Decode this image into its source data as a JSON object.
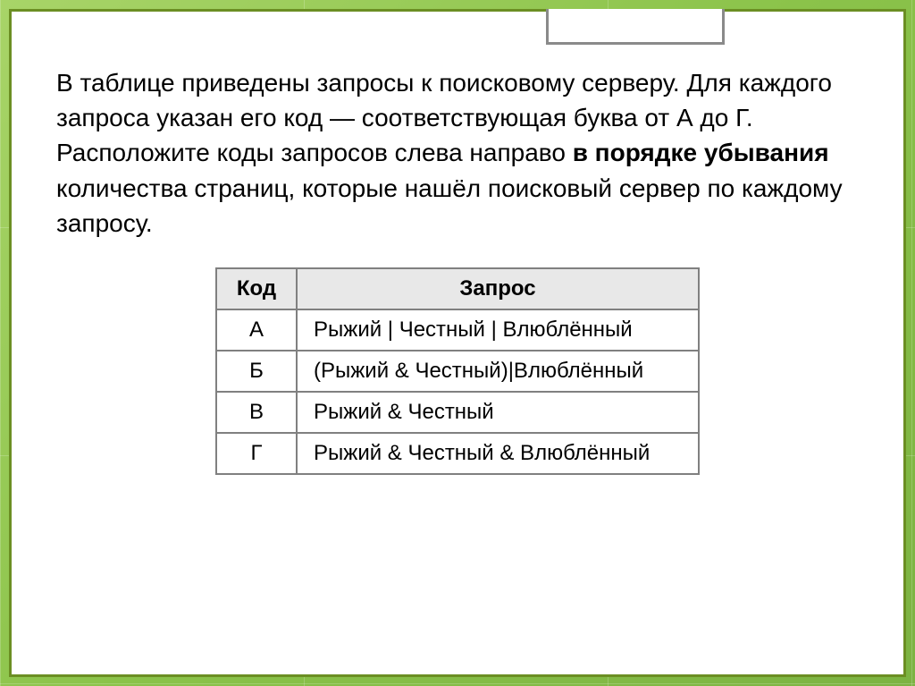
{
  "description": {
    "part1": "В таблице приведены запросы к поисковому серверу. Для каждого запроса указан его код — соответствующая буква от А до Г. Расположите коды запросов слева направо ",
    "bold": "в порядке убывания",
    "part2": " количества страниц, которые нашёл поисковый сервер по каждому запросу."
  },
  "table": {
    "headers": {
      "code": "Код",
      "query": "Запрос"
    },
    "rows": [
      {
        "code": "А",
        "query": "Рыжий | Честный | Влюблённый"
      },
      {
        "code": "Б",
        "query": "(Рыжий & Честный)|Влюблённый"
      },
      {
        "code": "В",
        "query": "Рыжий & Честный"
      },
      {
        "code": "Г",
        "query": "Рыжий & Честный & Влюблённый"
      }
    ]
  }
}
